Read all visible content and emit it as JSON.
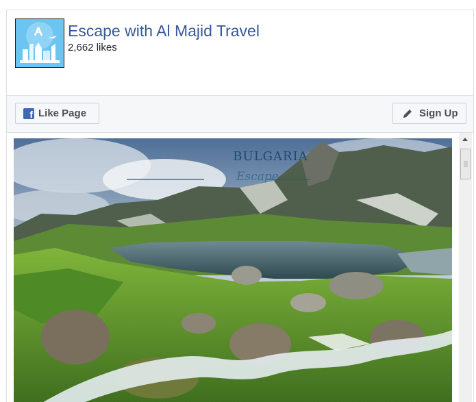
{
  "page": {
    "name": "Escape with Al Majid Travel",
    "likes": "2,662 likes"
  },
  "actions": {
    "like_label": "Like Page",
    "signup_label": "Sign Up"
  },
  "post": {
    "banner_title": "BULGARIA",
    "banner_subtitle": "Escape"
  },
  "colors": {
    "link_blue": "#365899",
    "facebook_blue": "#4267b2",
    "border": "#dddfe2"
  },
  "icons": [
    "facebook-f-icon",
    "pencil-icon",
    "scroll-up-arrow-icon"
  ]
}
